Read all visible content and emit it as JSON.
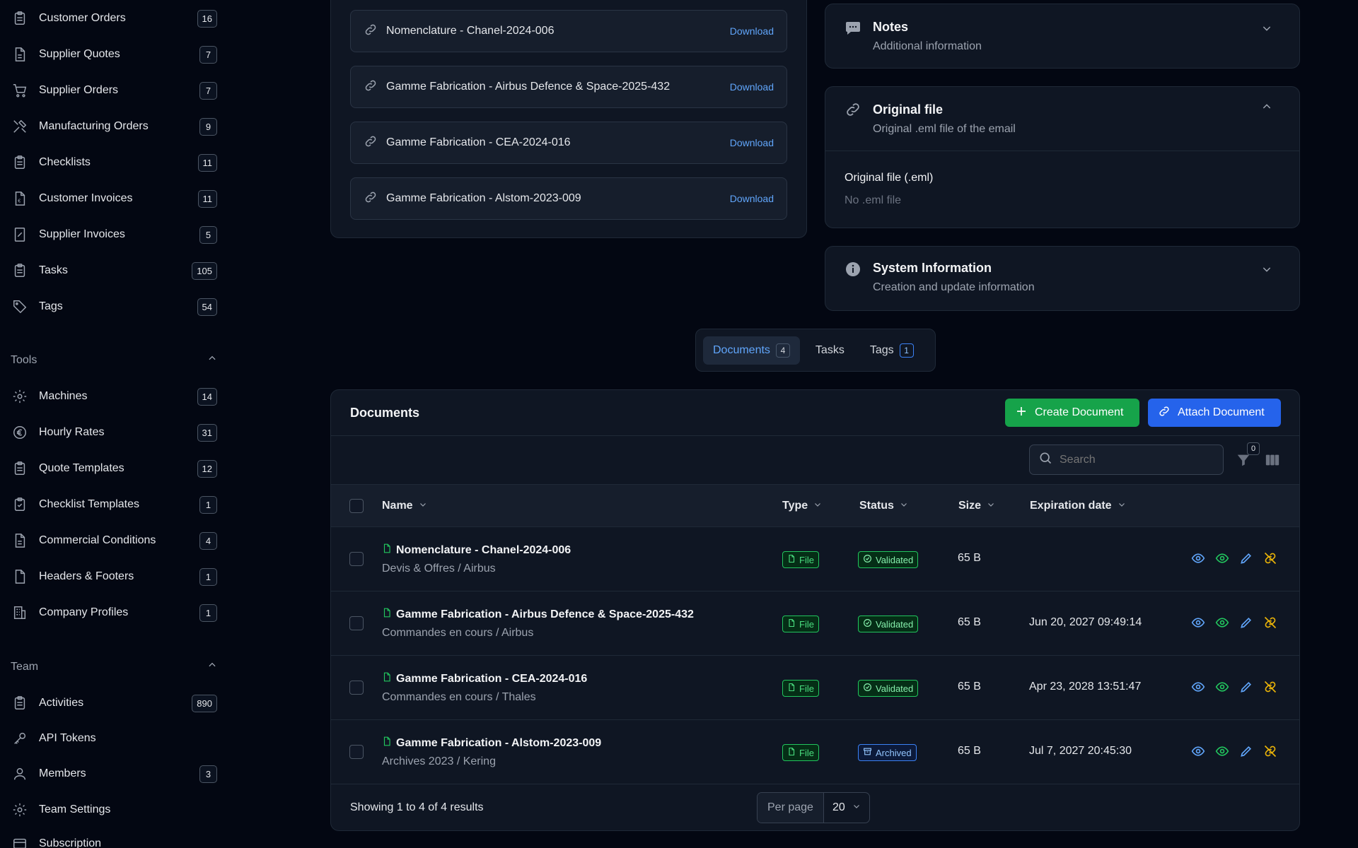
{
  "sidebar": {
    "items_top": [
      {
        "label": "Customer Orders",
        "count": "16",
        "icon": "clipboard-icon"
      },
      {
        "label": "Supplier Quotes",
        "count": "7",
        "icon": "document-icon"
      },
      {
        "label": "Supplier Orders",
        "count": "7",
        "icon": "cart-icon"
      },
      {
        "label": "Manufacturing Orders",
        "count": "9",
        "icon": "tools-icon"
      },
      {
        "label": "Checklists",
        "count": "11",
        "icon": "clipboard-icon"
      },
      {
        "label": "Customer Invoices",
        "count": "11",
        "icon": "invoice-icon"
      },
      {
        "label": "Supplier Invoices",
        "count": "5",
        "icon": "receipt-icon"
      },
      {
        "label": "Tasks",
        "count": "105",
        "icon": "clipboard-icon"
      },
      {
        "label": "Tags",
        "count": "54",
        "icon": "tag-icon"
      }
    ],
    "tools_label": "Tools",
    "tools": [
      {
        "label": "Machines",
        "count": "14",
        "icon": "gear-icon"
      },
      {
        "label": "Hourly Rates",
        "count": "31",
        "icon": "euro-icon"
      },
      {
        "label": "Quote Templates",
        "count": "12",
        "icon": "clipboard-icon"
      },
      {
        "label": "Checklist Templates",
        "count": "1",
        "icon": "clipboard-check-icon"
      },
      {
        "label": "Commercial Conditions",
        "count": "4",
        "icon": "document-icon"
      },
      {
        "label": "Headers & Footers",
        "count": "1",
        "icon": "document-icon"
      },
      {
        "label": "Company Profiles",
        "count": "1",
        "icon": "building-icon"
      }
    ],
    "team_label": "Team",
    "team": [
      {
        "label": "Activities",
        "count": "890",
        "icon": "clipboard-icon"
      },
      {
        "label": "API Tokens",
        "count": "",
        "icon": "key-icon"
      },
      {
        "label": "Members",
        "count": "3",
        "icon": "user-icon"
      },
      {
        "label": "Team Settings",
        "count": "",
        "icon": "gear-icon"
      },
      {
        "label": "Subscription",
        "count": "",
        "icon": "card-icon"
      }
    ]
  },
  "attachments": {
    "download_label": "Download",
    "items": [
      "Nomenclature - Chanel-2024-006",
      "Gamme Fabrication - Airbus Defence & Space-2025-432",
      "Gamme Fabrication - CEA-2024-016",
      "Gamme Fabrication - Alstom-2023-009"
    ]
  },
  "notes": {
    "title": "Notes",
    "subtitle": "Additional information"
  },
  "original_file": {
    "title": "Original file",
    "subtitle": "Original .eml file of the email",
    "field_label": "Original file (.eml)",
    "field_value": "No .eml file"
  },
  "system_info": {
    "title": "System Information",
    "subtitle": "Creation and update information"
  },
  "tabs": [
    {
      "label": "Documents",
      "count": "4"
    },
    {
      "label": "Tasks",
      "count": ""
    },
    {
      "label": "Tags",
      "count": "1"
    }
  ],
  "documents": {
    "title": "Documents",
    "create_label": "Create Document",
    "attach_label": "Attach Document",
    "search_placeholder": "Search",
    "filter_count": "0",
    "columns": {
      "name": "Name",
      "type": "Type",
      "status": "Status",
      "size": "Size",
      "expiration": "Expiration date"
    },
    "rows": [
      {
        "name": "Nomenclature - Chanel-2024-006",
        "path": "Devis & Offres / Airbus",
        "type": "File",
        "status": "Validated",
        "size": "65 B",
        "expiration": ""
      },
      {
        "name": "Gamme Fabrication - Airbus Defence & Space-2025-432",
        "path": "Commandes en cours / Airbus",
        "type": "File",
        "status": "Validated",
        "size": "65 B",
        "expiration": "Jun 20, 2027 09:49:14"
      },
      {
        "name": "Gamme Fabrication - CEA-2024-016",
        "path": "Commandes en cours / Thales",
        "type": "File",
        "status": "Validated",
        "size": "65 B",
        "expiration": "Apr 23, 2028 13:51:47"
      },
      {
        "name": "Gamme Fabrication - Alstom-2023-009",
        "path": "Archives 2023 / Kering",
        "type": "File",
        "status": "Archived",
        "size": "65 B",
        "expiration": "Jul 7, 2027 20:45:30"
      }
    ],
    "footer_text": "Showing 1 to 4 of 4 results",
    "per_page_label": "Per page",
    "per_page_value": "20"
  },
  "colors": {
    "background": "#030712",
    "panel": "#0f1623",
    "accent_blue": "#2563eb",
    "accent_green": "#16a34a",
    "link": "#60a5fa",
    "unlink": "#eab308"
  }
}
